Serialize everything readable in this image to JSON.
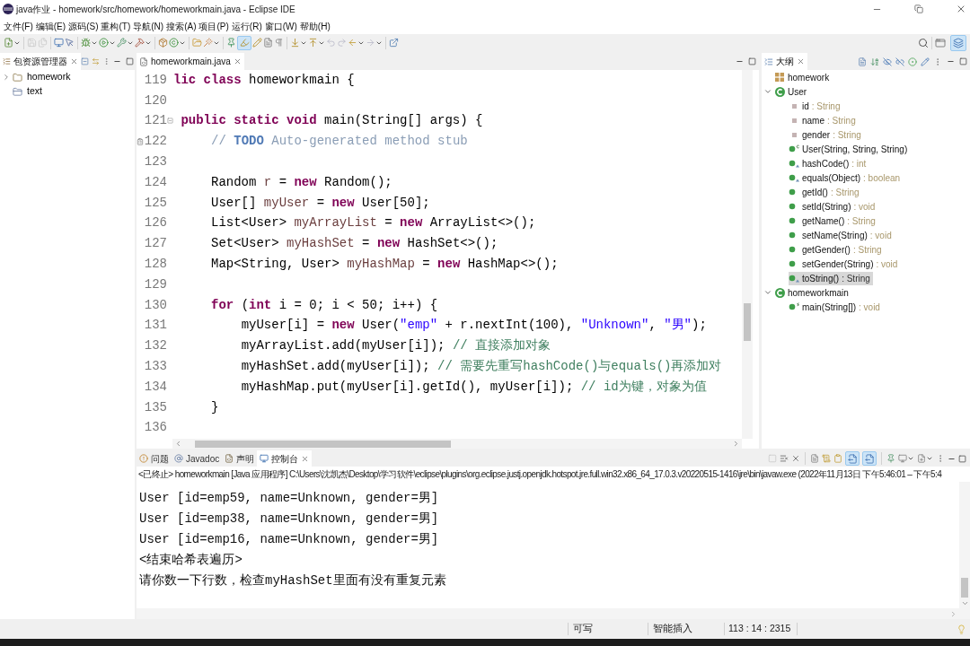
{
  "window": {
    "title": "java作业 - homework/src/homework/homeworkmain.java - Eclipse IDE"
  },
  "menu_bar": [
    "文件(F)",
    "编辑(E)",
    "源码(S)",
    "重构(T)",
    "导航(N)",
    "搜索(A)",
    "项目(P)",
    "运行(R)",
    "窗口(W)",
    "帮助(H)"
  ],
  "toolbar": {
    "save_button": {
      "disabled": true
    },
    "save_all_button": {
      "disabled": true
    },
    "mark_occurrences_toggle": {
      "on": true
    },
    "java_perspective_button": {
      "selected": true
    }
  },
  "package_explorer": {
    "tab": {
      "label": "包资源管理器",
      "selected": true
    },
    "items": [
      {
        "kind": "project",
        "label": "homework",
        "expanded": false,
        "selected": false
      },
      {
        "kind": "closed_project",
        "label": "text",
        "selected": false
      }
    ]
  },
  "editor": {
    "tabs": [
      {
        "label": "homeworkmain.java",
        "selected": true
      }
    ],
    "lines": [
      {
        "number": "119",
        "tokens": [
          {
            "kind": "keyword",
            "text": "lic class"
          },
          {
            "kind": "plain",
            "text": " homeworkmain {"
          }
        ]
      },
      {
        "number": "120"
      },
      {
        "number": "121",
        "marker": {
          "kind": "fold"
        },
        "tokens": [
          {
            "kind": "keyword",
            "text": " public static void"
          },
          {
            "kind": "plain",
            "text": " main(String[] args) {"
          }
        ]
      },
      {
        "number": "122",
        "marker": {
          "kind": "task"
        },
        "tokens": [
          {
            "kind": "doc_comment",
            "text": "     // "
          },
          {
            "kind": "task_tag",
            "text": "TODO"
          },
          {
            "kind": "doc_comment",
            "text": " Auto-generated method stub"
          }
        ]
      },
      {
        "number": "123"
      },
      {
        "number": "124",
        "tokens": [
          {
            "kind": "plain",
            "text": "     Random "
          },
          {
            "kind": "local",
            "text": "r"
          },
          {
            "kind": "plain",
            "text": " = "
          },
          {
            "kind": "keyword",
            "text": "new"
          },
          {
            "kind": "plain",
            "text": " Random();"
          }
        ]
      },
      {
        "number": "125",
        "tokens": [
          {
            "kind": "plain",
            "text": "     User[] "
          },
          {
            "kind": "local",
            "text": "myUser"
          },
          {
            "kind": "plain",
            "text": " = "
          },
          {
            "kind": "keyword",
            "text": "new"
          },
          {
            "kind": "plain",
            "text": " User[50];"
          }
        ]
      },
      {
        "number": "126",
        "tokens": [
          {
            "kind": "plain",
            "text": "     List<User> "
          },
          {
            "kind": "local",
            "text": "myArrayList"
          },
          {
            "kind": "plain",
            "text": " = "
          },
          {
            "kind": "keyword",
            "text": "new"
          },
          {
            "kind": "plain",
            "text": " ArrayList<>();"
          }
        ]
      },
      {
        "number": "127",
        "tokens": [
          {
            "kind": "plain",
            "text": "     Set<User> "
          },
          {
            "kind": "local",
            "text": "myHashSet"
          },
          {
            "kind": "plain",
            "text": " = "
          },
          {
            "kind": "keyword",
            "text": "new"
          },
          {
            "kind": "plain",
            "text": " HashSet<>();"
          }
        ]
      },
      {
        "number": "128",
        "tokens": [
          {
            "kind": "plain",
            "text": "     Map<String, User> "
          },
          {
            "kind": "local",
            "text": "myHashMap"
          },
          {
            "kind": "plain",
            "text": " = "
          },
          {
            "kind": "keyword",
            "text": "new"
          },
          {
            "kind": "plain",
            "text": " HashMap<>();"
          }
        ]
      },
      {
        "number": "129"
      },
      {
        "number": "130",
        "tokens": [
          {
            "kind": "keyword",
            "text": "     for"
          },
          {
            "kind": "plain",
            "text": " ("
          },
          {
            "kind": "keyword",
            "text": "int"
          },
          {
            "kind": "plain",
            "text": " i = 0; i < 50; i++) {"
          }
        ]
      },
      {
        "number": "131",
        "tokens": [
          {
            "kind": "plain",
            "text": "         myUser[i] = "
          },
          {
            "kind": "keyword",
            "text": "new"
          },
          {
            "kind": "plain",
            "text": " User("
          },
          {
            "kind": "string",
            "text": "\"emp\""
          },
          {
            "kind": "plain",
            "text": " + r.nextInt(100), "
          },
          {
            "kind": "string",
            "text": "\"Unknown\""
          },
          {
            "kind": "plain",
            "text": ", "
          },
          {
            "kind": "string",
            "text": "\"男\""
          },
          {
            "kind": "plain",
            "text": ");"
          }
        ]
      },
      {
        "number": "132",
        "tokens": [
          {
            "kind": "plain",
            "text": "         myArrayList.add(myUser[i]); "
          },
          {
            "kind": "comment",
            "text": "// 直接添加对象"
          }
        ]
      },
      {
        "number": "133",
        "tokens": [
          {
            "kind": "plain",
            "text": "         myHashSet.add(myUser[i]); "
          },
          {
            "kind": "comment",
            "text": "// 需要先重写hashCode()与equals()再添加对"
          }
        ]
      },
      {
        "number": "134",
        "tokens": [
          {
            "kind": "plain",
            "text": "         myHashMap.put(myUser[i].getId(), myUser[i]); "
          },
          {
            "kind": "comment",
            "text": "// id为键，对象为值"
          }
        ]
      },
      {
        "number": "135",
        "tokens": [
          {
            "kind": "plain",
            "text": "     }"
          }
        ]
      },
      {
        "number": "136"
      }
    ]
  },
  "outline": {
    "tab": {
      "label": "大纲",
      "selected": true
    },
    "items": [
      {
        "kind": "package",
        "name": "homework",
        "selected": false
      },
      {
        "kind": "class",
        "name": "User",
        "expanded": true,
        "selected": false,
        "children": [
          {
            "kind": "field",
            "name": "id",
            "detail": ": String",
            "selected": false
          },
          {
            "kind": "field",
            "name": "name",
            "detail": ": String",
            "selected": false
          },
          {
            "kind": "field",
            "name": "gender",
            "detail": ": String",
            "selected": false
          },
          {
            "kind": "constructor",
            "name": "User(String, String, String)",
            "selected": false
          },
          {
            "kind": "override_method",
            "name": "hashCode()",
            "detail": ": int",
            "selected": false
          },
          {
            "kind": "override_method",
            "name": "equals(Object)",
            "detail": ": boolean",
            "selected": false
          },
          {
            "kind": "method",
            "name": "getId()",
            "detail": ": String",
            "selected": false
          },
          {
            "kind": "method",
            "name": "setId(String)",
            "detail": ": void",
            "selected": false
          },
          {
            "kind": "method",
            "name": "getName()",
            "detail": ": String",
            "selected": false
          },
          {
            "kind": "method",
            "name": "setName(String)",
            "detail": ": void",
            "selected": false
          },
          {
            "kind": "method",
            "name": "getGender()",
            "detail": ": String",
            "selected": false
          },
          {
            "kind": "method",
            "name": "setGender(String)",
            "detail": ": void",
            "selected": false
          },
          {
            "kind": "override_method",
            "name": "toString()",
            "detail": ": String",
            "selected": true
          }
        ]
      },
      {
        "kind": "class",
        "name": "homeworkmain",
        "expanded": true,
        "selected": false,
        "children": [
          {
            "kind": "static_method",
            "name": "main(String[])",
            "detail": ": void",
            "selected": false
          }
        ]
      }
    ]
  },
  "console": {
    "tabs": [
      {
        "label": "问题",
        "selected": false
      },
      {
        "label": "Javadoc",
        "selected": false
      },
      {
        "label": "声明",
        "selected": false
      },
      {
        "label": "控制台",
        "selected": true
      }
    ],
    "toolbar_toggles": [
      {
        "on": true
      },
      {
        "on": true
      }
    ],
    "description": "<已终止> homeworkmain [Java 应用程序] C:\\Users\\沈凯杰\\Desktop\\学习软件\\eclipse\\plugins\\org.eclipse.justj.openjdk.hotspot.jre.full.win32.x86_64_17.0.3.v20220515-1416\\jre\\bin\\javaw.exe  (2022年11月13日 下午5:46:01 – 下午5:4",
    "lines": [
      "User [id=emp59, name=Unknown, gender=男]",
      "User [id=emp38, name=Unknown, gender=男]",
      "User [id=emp16, name=Unknown, gender=男]",
      "<结束哈希表遍历>",
      "请你数一下行数，检查myHashSet里面有没有重复元素"
    ]
  },
  "status_bar": {
    "access": "可写",
    "insert_mode": "智能插入",
    "position": "113 : 14 : 2315"
  }
}
